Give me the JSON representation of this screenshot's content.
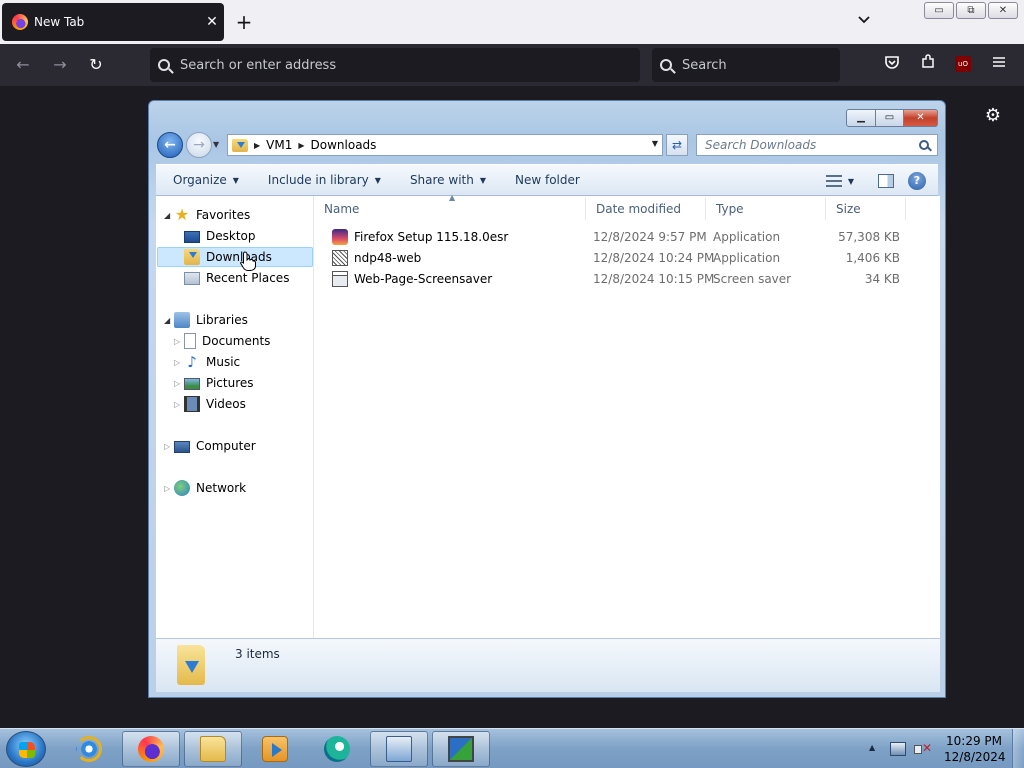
{
  "browser": {
    "tab_title": "New Tab",
    "tab_close": "✕",
    "new_tab": "+",
    "tab_list": "⌄",
    "address_placeholder": "Search or enter address",
    "search_placeholder": "Search",
    "ublock_label": "uO"
  },
  "explorer": {
    "breadcrumbs": [
      "VM1",
      "Downloads"
    ],
    "search_placeholder": "Search Downloads",
    "commands": {
      "organize": "Organize",
      "include_in_library": "Include in library",
      "share_with": "Share with",
      "new_folder": "New folder"
    },
    "nav": {
      "favorites": "Favorites",
      "desktop": "Desktop",
      "downloads": "Downloads",
      "recent_places": "Recent Places",
      "libraries": "Libraries",
      "documents": "Documents",
      "music": "Music",
      "pictures": "Pictures",
      "videos": "Videos",
      "computer": "Computer",
      "network": "Network"
    },
    "columns": {
      "name": "Name",
      "date_modified": "Date modified",
      "type": "Type",
      "size": "Size"
    },
    "files": [
      {
        "name": "Firefox Setup 115.18.0esr",
        "date": "12/8/2024 9:57 PM",
        "type": "Application",
        "size": "57,308 KB"
      },
      {
        "name": "ndp48-web",
        "date": "12/8/2024 10:24 PM",
        "type": "Application",
        "size": "1,406 KB"
      },
      {
        "name": "Web-Page-Screensaver",
        "date": "12/8/2024 10:15 PM",
        "type": "Screen saver",
        "size": "34 KB"
      }
    ],
    "item_count": "3 items"
  },
  "taskbar": {
    "time": "10:29 PM",
    "date": "12/8/2024"
  },
  "colors": {
    "browser_dark": "#1c1b22",
    "nav_selected": "#cce8ff",
    "close_red": "#c3422c"
  }
}
